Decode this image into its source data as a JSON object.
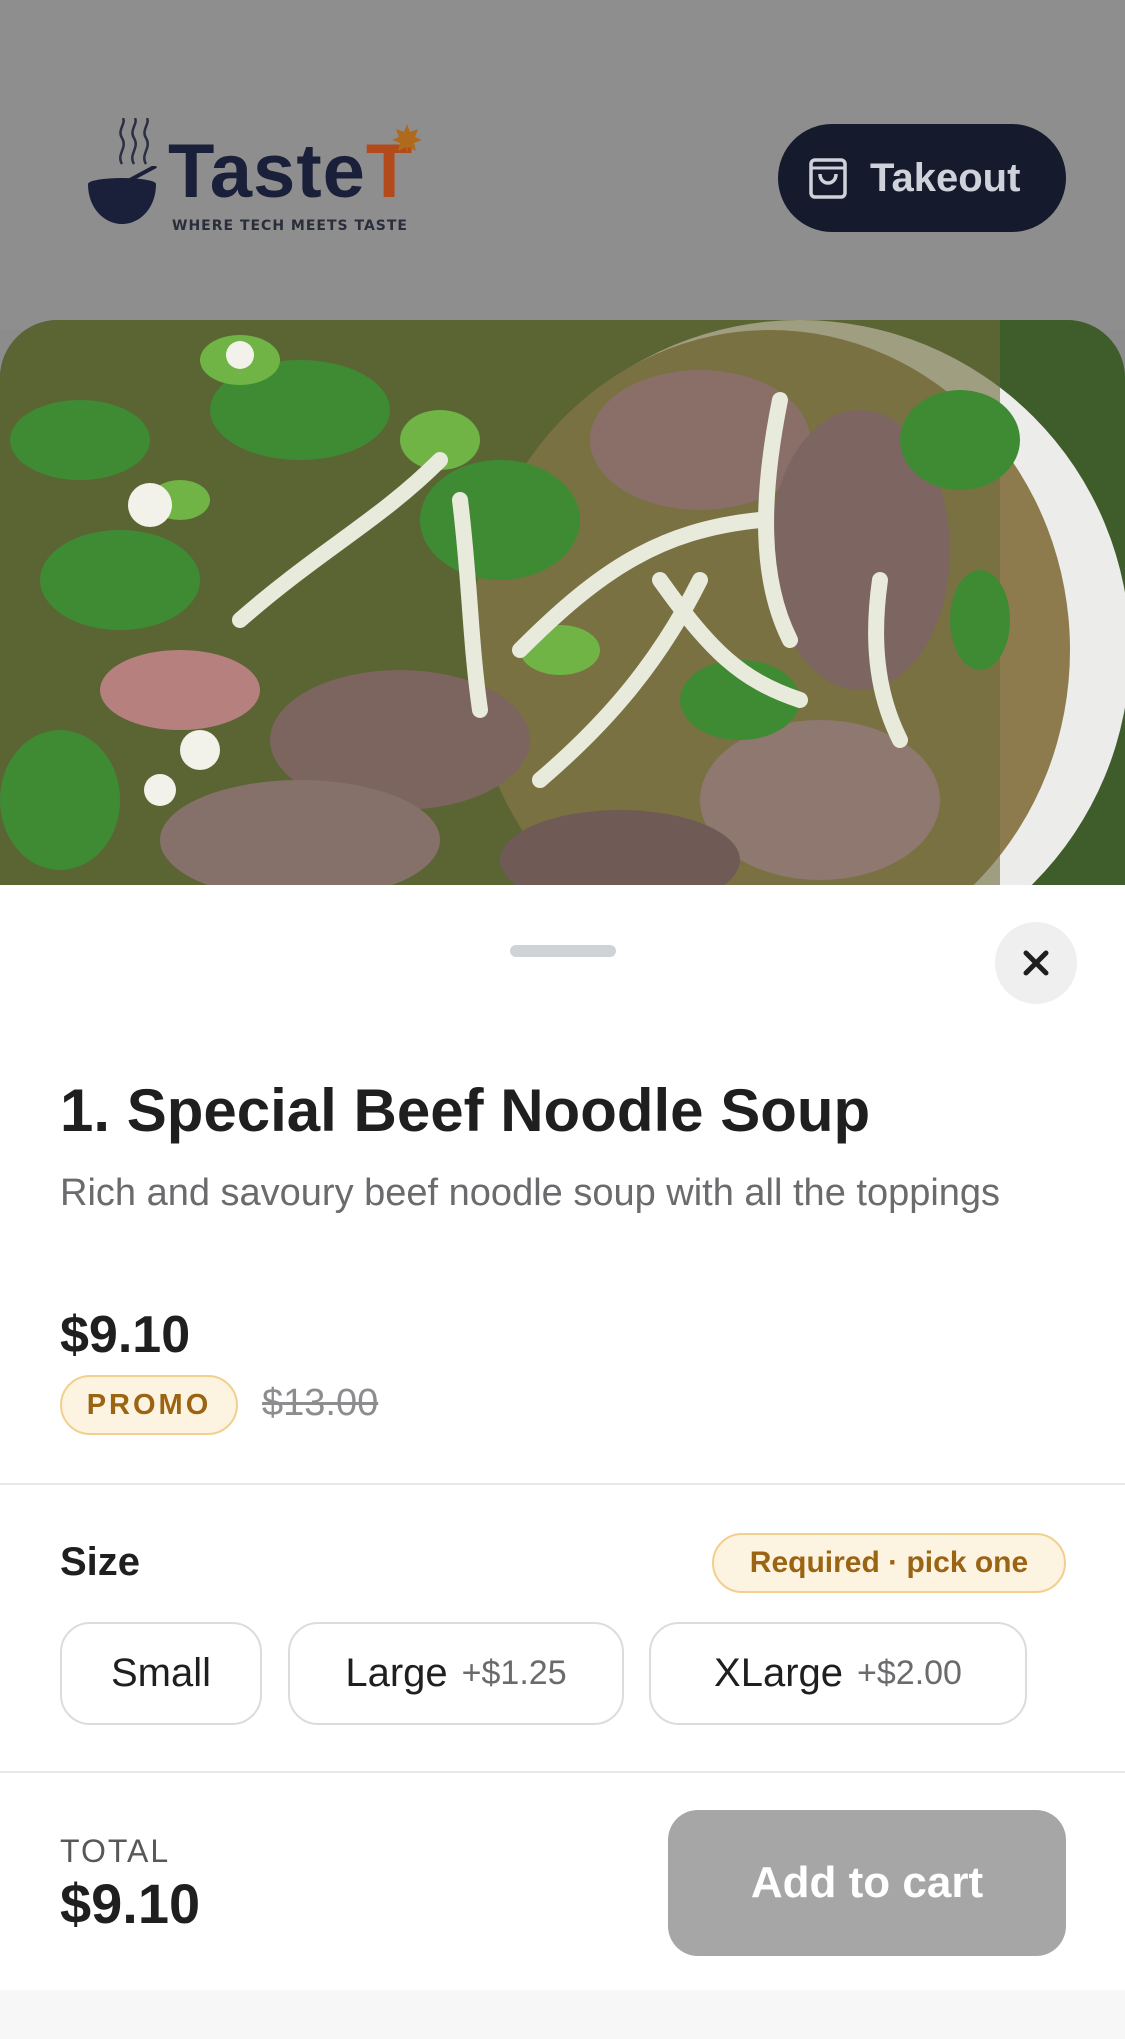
{
  "header": {
    "logo_name_main": "Taste",
    "logo_name_accent": "T",
    "logo_tagline": "WHERE TECH MEETS TASTE",
    "mode_button_label": "Takeout",
    "mode_button_icon": "shopping-bag-icon"
  },
  "hero": {
    "image_subject": "beef noodle soup bowl"
  },
  "item": {
    "title": "1. Special Beef Noodle Soup",
    "description": "Rich and savoury beef noodle soup with all the toppings",
    "price": "$9.10",
    "promo_badge": "PROMO",
    "original_price": "$13.00"
  },
  "size_group": {
    "label": "Size",
    "requirement": "Required · pick one",
    "options": [
      {
        "label": "Small",
        "extra": ""
      },
      {
        "label": "Large",
        "extra": "+$1.25"
      },
      {
        "label": "XLarge",
        "extra": "+$2.00"
      }
    ]
  },
  "footer": {
    "total_label": "TOTAL",
    "total_value": "$9.10",
    "add_button_label": "Add to cart"
  },
  "colors": {
    "brand_navy": "#151b2c",
    "brand_accent": "#b34a1c",
    "promo_text": "#9a6412",
    "promo_bg": "#fdf3e1",
    "disabled_button": "#a6a6a6"
  }
}
